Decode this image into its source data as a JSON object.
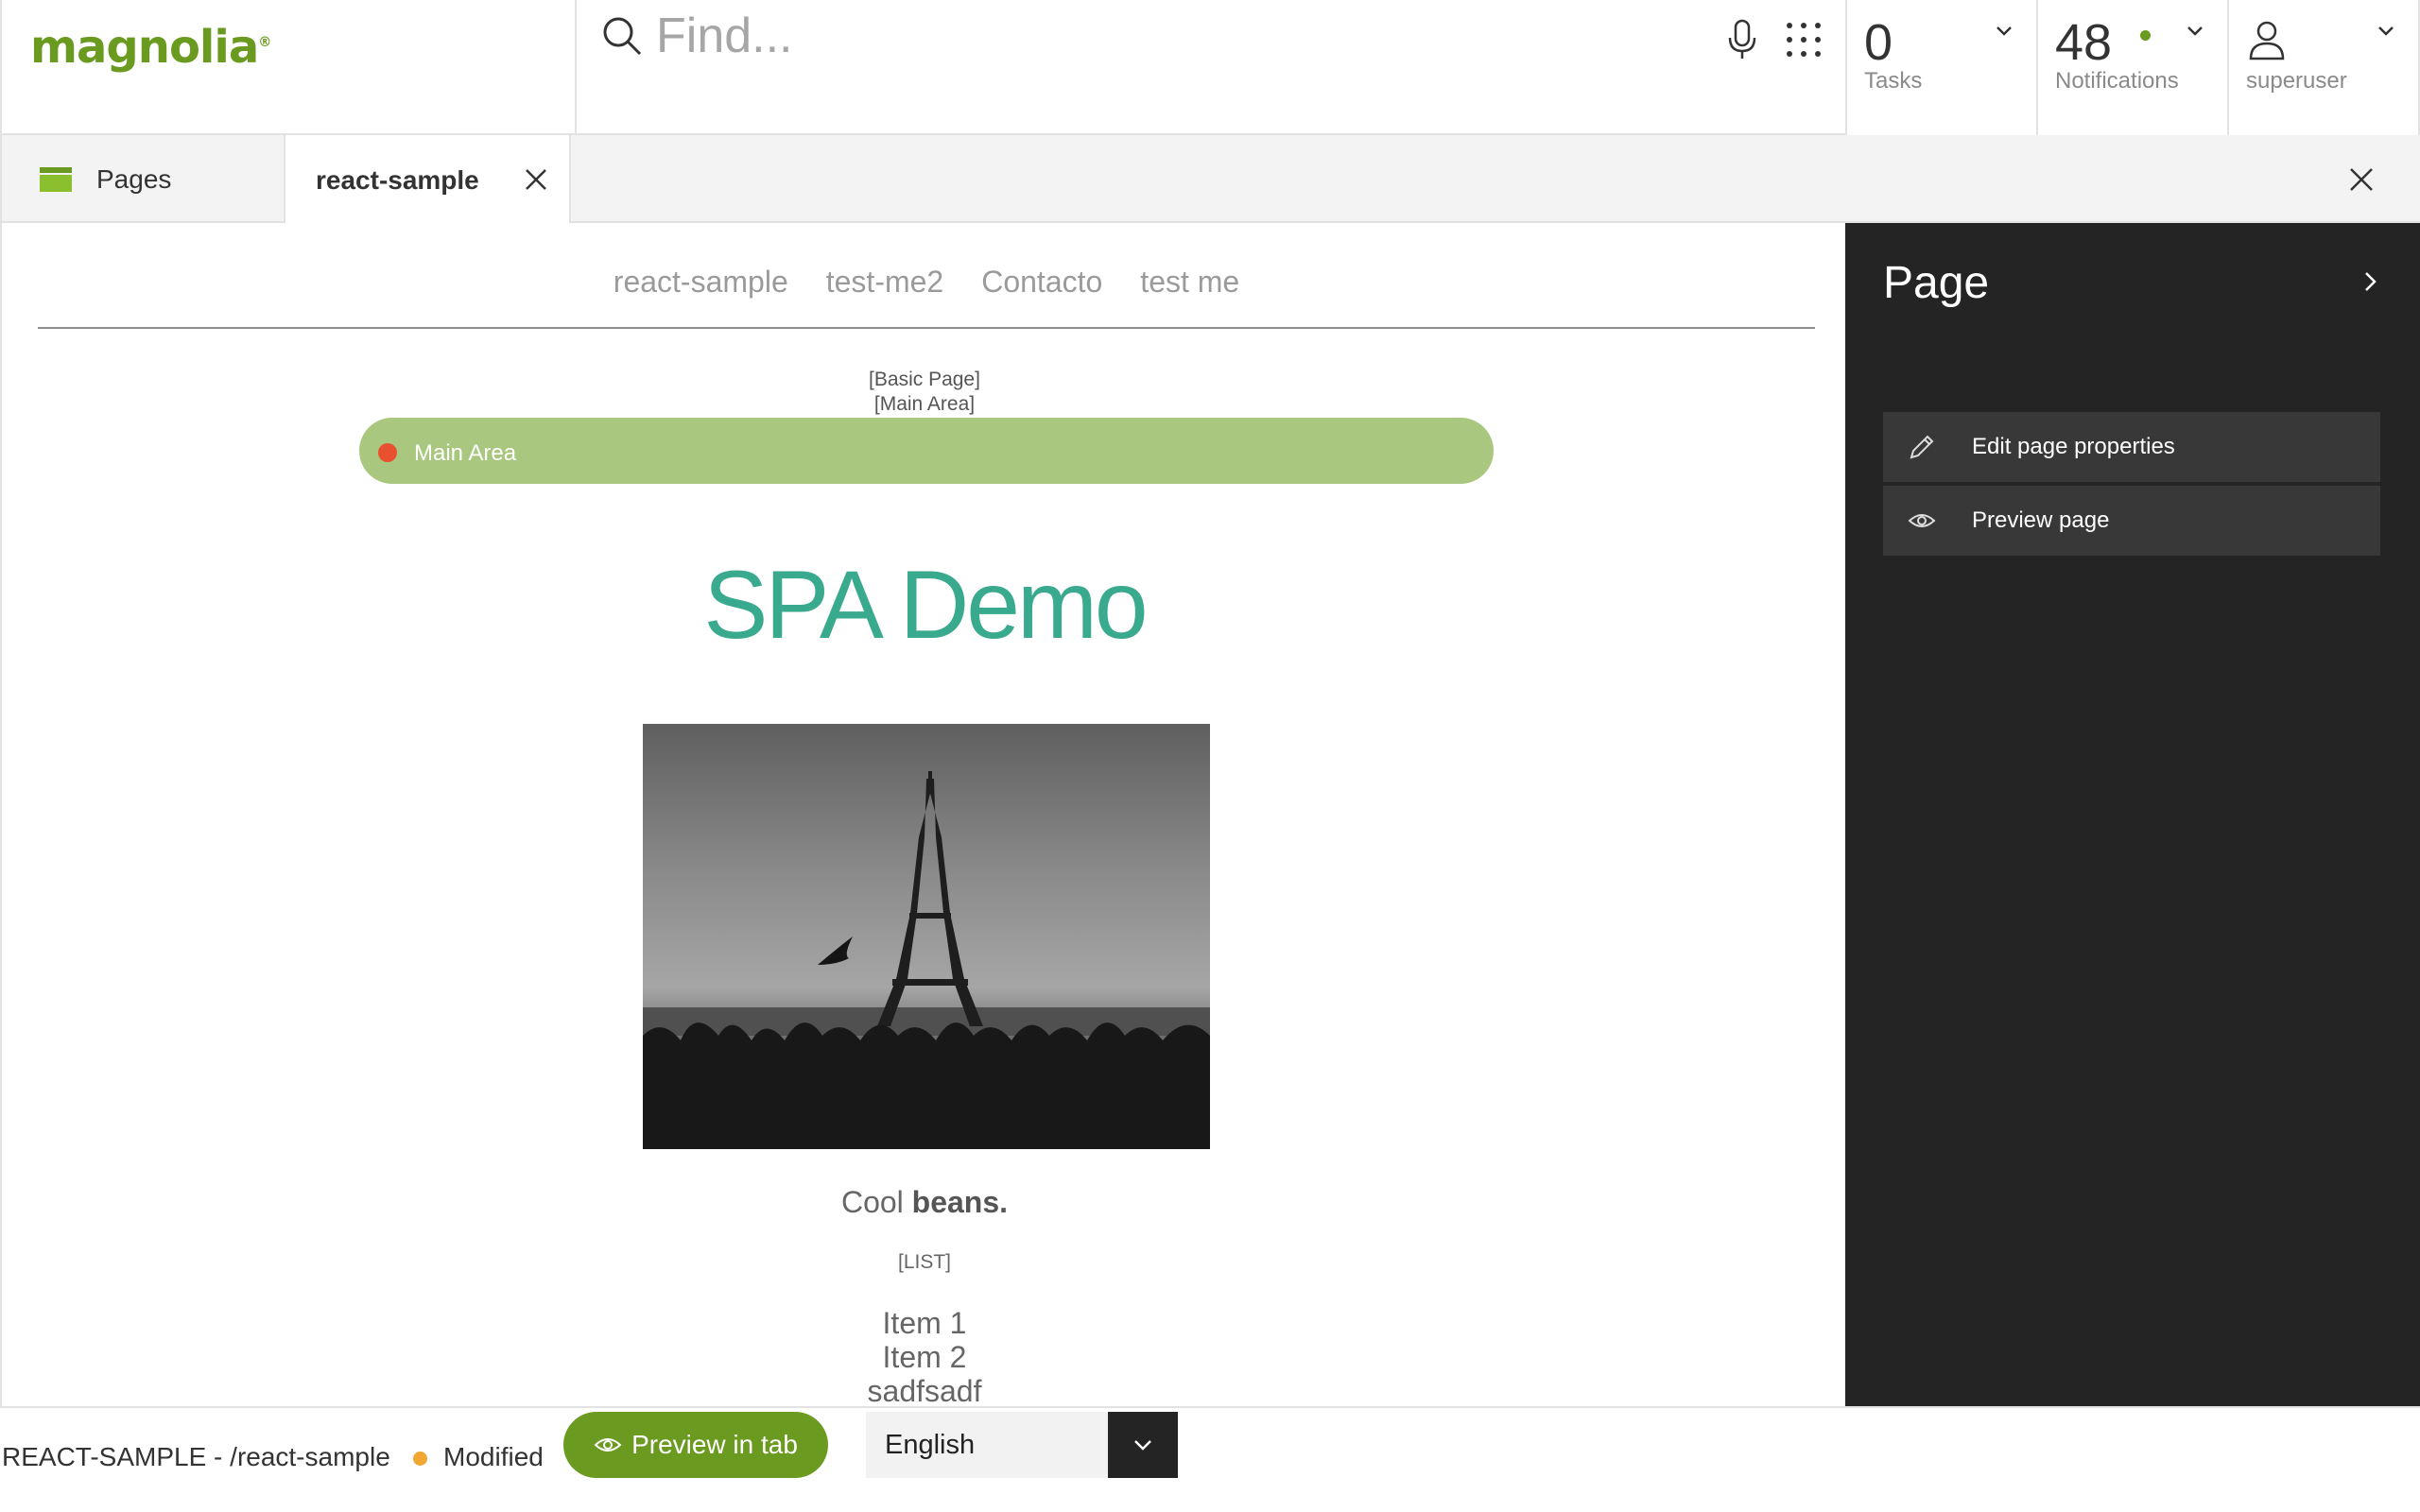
{
  "header": {
    "logo_text": "magnolia",
    "logo_mark": "®",
    "search": {
      "placeholder": "Find..."
    },
    "tasks": {
      "count": "0",
      "label": "Tasks"
    },
    "notifications": {
      "count": "48",
      "label": "Notifications"
    },
    "user": {
      "label": "superuser"
    }
  },
  "tabs": {
    "pages_label": "Pages",
    "active_label": "react-sample"
  },
  "site": {
    "nav": [
      "react-sample",
      "test-me2",
      "Contacto",
      "test me"
    ],
    "basic_page_tag": "[Basic Page]",
    "main_area_tag": "[Main Area]",
    "main_area_label": "Main Area",
    "title": "SPA Demo",
    "caption_plain": "Cool ",
    "caption_bold": "beans.",
    "list_tag": "[LIST]",
    "list_items": [
      "Item 1",
      "Item 2",
      "sadfsadf"
    ]
  },
  "panel": {
    "title": "Page",
    "actions": [
      {
        "label": "Edit page properties",
        "icon": "pencil-icon"
      },
      {
        "label": "Preview page",
        "icon": "preview-icon"
      }
    ]
  },
  "footer": {
    "path": "REACT-SAMPLE - /react-sample",
    "status": "Modified",
    "preview_button": "Preview in tab",
    "language": "English"
  },
  "colors": {
    "brand_green": "#6a9a1f",
    "main_area_green": "#a9c77e",
    "title_teal": "#3aaa8e",
    "panel_dark": "#242424",
    "modified_orange": "#f0a833",
    "area_dot_red": "#e8502f"
  }
}
